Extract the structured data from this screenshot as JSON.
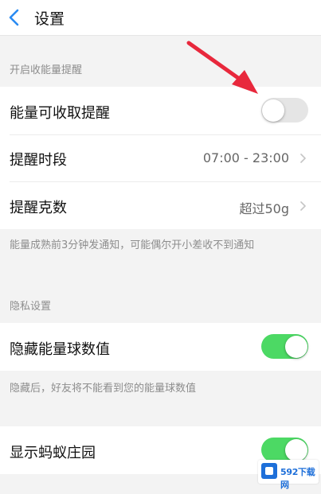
{
  "header": {
    "title": "设置"
  },
  "sections": {
    "energy_header": "开启收能量提醒",
    "privacy_header": "隐私设置"
  },
  "rows": {
    "energy_reminder": {
      "label": "能量可收取提醒",
      "toggle_on": false
    },
    "reminder_period": {
      "label": "提醒时段",
      "value": "07:00 - 23:00"
    },
    "reminder_grams": {
      "label": "提醒克数",
      "value": "超过50g"
    },
    "hide_energy": {
      "label": "隐藏能量球数值",
      "toggle_on": true
    },
    "show_ant_manor": {
      "label": "显示蚂蚁庄园",
      "toggle_on": true
    }
  },
  "notes": {
    "energy_note": "能量成熟前3分钟发通知，可能偶尔开小差收不到通知",
    "hide_note": "隐藏后，好友将不能看到您的能量球数值"
  },
  "colors": {
    "toggle_on": "#4cd964",
    "toggle_off": "#e5e5e5",
    "back_arrow": "#2a8bf2",
    "annotation_arrow": "#e8283c"
  },
  "watermark": {
    "text": "592下载网"
  }
}
